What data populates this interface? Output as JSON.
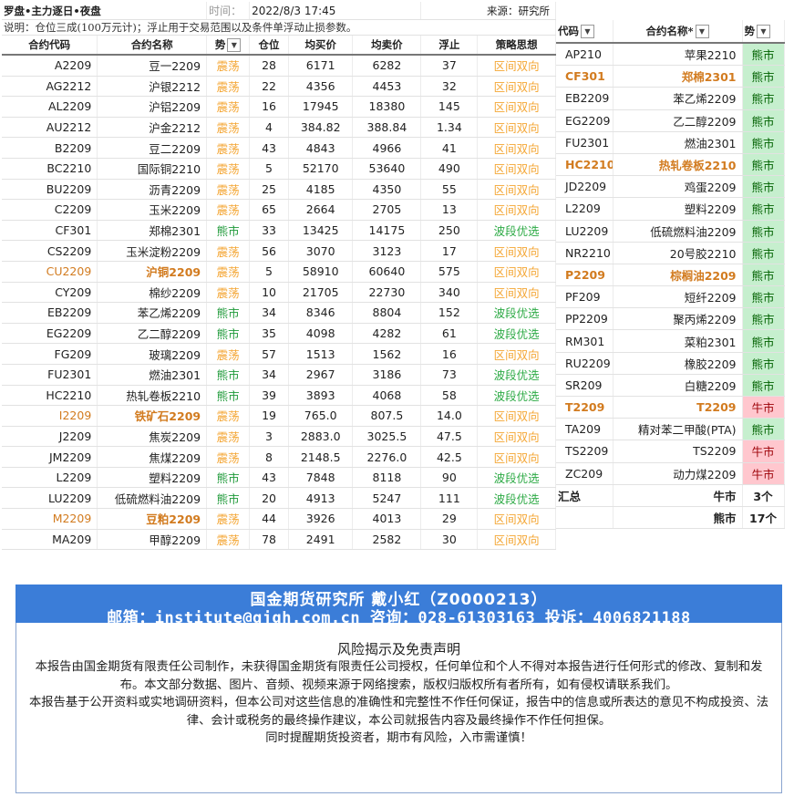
{
  "header": {
    "title": "罗盘•主力逐日•夜盘",
    "time_label": "时间：",
    "time_value": "2022/8/3 17:45",
    "source": "来源：研究所",
    "note": "说明：仓位三成(100万元计)；浮止用于交易范围以及条件单浮动止损参数。"
  },
  "left_table": {
    "columns": [
      "合约代码",
      "合约名称",
      "势",
      "仓位",
      "均买价",
      "均卖价",
      "浮止",
      "策略思想"
    ],
    "rows": [
      {
        "code": "A2209",
        "name": "豆一2209",
        "trend": "震荡",
        "pos": "28",
        "buy": "6171",
        "sell": "6282",
        "stop": "37",
        "strategy": "区间双向",
        "hl": false
      },
      {
        "code": "AG2212",
        "name": "沪银2212",
        "trend": "震荡",
        "pos": "22",
        "buy": "4356",
        "sell": "4453",
        "stop": "32",
        "strategy": "区间双向",
        "hl": false
      },
      {
        "code": "AL2209",
        "name": "沪铝2209",
        "trend": "震荡",
        "pos": "16",
        "buy": "17945",
        "sell": "18380",
        "stop": "145",
        "strategy": "区间双向",
        "hl": false
      },
      {
        "code": "AU2212",
        "name": "沪金2212",
        "trend": "震荡",
        "pos": "4",
        "buy": "384.82",
        "sell": "388.84",
        "stop": "1.34",
        "strategy": "区间双向",
        "hl": false
      },
      {
        "code": "B2209",
        "name": "豆二2209",
        "trend": "震荡",
        "pos": "43",
        "buy": "4843",
        "sell": "4966",
        "stop": "41",
        "strategy": "区间双向",
        "hl": false
      },
      {
        "code": "BC2210",
        "name": "国际铜2210",
        "trend": "震荡",
        "pos": "5",
        "buy": "52170",
        "sell": "53640",
        "stop": "490",
        "strategy": "区间双向",
        "hl": false
      },
      {
        "code": "BU2209",
        "name": "沥青2209",
        "trend": "震荡",
        "pos": "25",
        "buy": "4185",
        "sell": "4350",
        "stop": "55",
        "strategy": "区间双向",
        "hl": false
      },
      {
        "code": "C2209",
        "name": "玉米2209",
        "trend": "震荡",
        "pos": "65",
        "buy": "2664",
        "sell": "2705",
        "stop": "13",
        "strategy": "区间双向",
        "hl": false
      },
      {
        "code": "CF301",
        "name": "郑棉2301",
        "trend": "熊市",
        "pos": "33",
        "buy": "13425",
        "sell": "14175",
        "stop": "250",
        "strategy": "波段优选",
        "hl": false
      },
      {
        "code": "CS2209",
        "name": "玉米淀粉2209",
        "trend": "震荡",
        "pos": "56",
        "buy": "3070",
        "sell": "3123",
        "stop": "17",
        "strategy": "区间双向",
        "hl": false
      },
      {
        "code": "CU2209",
        "name": "沪铜2209",
        "trend": "震荡",
        "pos": "5",
        "buy": "58910",
        "sell": "60640",
        "stop": "575",
        "strategy": "区间双向",
        "hl": true
      },
      {
        "code": "CY209",
        "name": "棉纱2209",
        "trend": "震荡",
        "pos": "10",
        "buy": "21705",
        "sell": "22730",
        "stop": "340",
        "strategy": "区间双向",
        "hl": false
      },
      {
        "code": "EB2209",
        "name": "苯乙烯2209",
        "trend": "熊市",
        "pos": "34",
        "buy": "8346",
        "sell": "8804",
        "stop": "152",
        "strategy": "波段优选",
        "hl": false
      },
      {
        "code": "EG2209",
        "name": "乙二醇2209",
        "trend": "熊市",
        "pos": "35",
        "buy": "4098",
        "sell": "4282",
        "stop": "61",
        "strategy": "波段优选",
        "hl": false
      },
      {
        "code": "FG209",
        "name": "玻璃2209",
        "trend": "震荡",
        "pos": "57",
        "buy": "1513",
        "sell": "1562",
        "stop": "16",
        "strategy": "区间双向",
        "hl": false
      },
      {
        "code": "FU2301",
        "name": "燃油2301",
        "trend": "熊市",
        "pos": "34",
        "buy": "2967",
        "sell": "3186",
        "stop": "73",
        "strategy": "波段优选",
        "hl": false
      },
      {
        "code": "HC2210",
        "name": "热轧卷板2210",
        "trend": "熊市",
        "pos": "39",
        "buy": "3893",
        "sell": "4068",
        "stop": "58",
        "strategy": "波段优选",
        "hl": false
      },
      {
        "code": "I2209",
        "name": "铁矿石2209",
        "trend": "震荡",
        "pos": "19",
        "buy": "765.0",
        "sell": "807.5",
        "stop": "14.0",
        "strategy": "区间双向",
        "hl": true
      },
      {
        "code": "J2209",
        "name": "焦炭2209",
        "trend": "震荡",
        "pos": "3",
        "buy": "2883.0",
        "sell": "3025.5",
        "stop": "47.5",
        "strategy": "区间双向",
        "hl": false
      },
      {
        "code": "JM2209",
        "name": "焦煤2209",
        "trend": "震荡",
        "pos": "8",
        "buy": "2148.5",
        "sell": "2276.0",
        "stop": "42.5",
        "strategy": "区间双向",
        "hl": false
      },
      {
        "code": "L2209",
        "name": "塑料2209",
        "trend": "熊市",
        "pos": "43",
        "buy": "7848",
        "sell": "8118",
        "stop": "90",
        "strategy": "波段优选",
        "hl": false
      },
      {
        "code": "LU2209",
        "name": "低硫燃料油2209",
        "trend": "熊市",
        "pos": "20",
        "buy": "4913",
        "sell": "5247",
        "stop": "111",
        "strategy": "波段优选",
        "hl": false
      },
      {
        "code": "M2209",
        "name": "豆粕2209",
        "trend": "震荡",
        "pos": "44",
        "buy": "3926",
        "sell": "4013",
        "stop": "29",
        "strategy": "区间双向",
        "hl": true
      },
      {
        "code": "MA209",
        "name": "甲醇2209",
        "trend": "震荡",
        "pos": "78",
        "buy": "2491",
        "sell": "2582",
        "stop": "30",
        "strategy": "区间双向",
        "hl": false
      }
    ]
  },
  "right_table": {
    "columns": [
      "代码",
      "合约名称*",
      "势"
    ],
    "rows": [
      {
        "code": "AP210",
        "name": "苹果2210",
        "trend": "熊市",
        "hl": false
      },
      {
        "code": "CF301",
        "name": "郑棉2301",
        "trend": "熊市",
        "hl": true
      },
      {
        "code": "EB2209",
        "name": "苯乙烯2209",
        "trend": "熊市",
        "hl": false
      },
      {
        "code": "EG2209",
        "name": "乙二醇2209",
        "trend": "熊市",
        "hl": false
      },
      {
        "code": "FU2301",
        "name": "燃油2301",
        "trend": "熊市",
        "hl": false
      },
      {
        "code": "HC2210",
        "name": "热轧卷板2210",
        "trend": "熊市",
        "hl": true
      },
      {
        "code": "JD2209",
        "name": "鸡蛋2209",
        "trend": "熊市",
        "hl": false
      },
      {
        "code": "L2209",
        "name": "塑料2209",
        "trend": "熊市",
        "hl": false
      },
      {
        "code": "LU2209",
        "name": "低硫燃料油2209",
        "trend": "熊市",
        "hl": false
      },
      {
        "code": "NR2210",
        "name": "20号胶2210",
        "trend": "熊市",
        "hl": false
      },
      {
        "code": "P2209",
        "name": "棕榈油2209",
        "trend": "熊市",
        "hl": true
      },
      {
        "code": "PF209",
        "name": "短纤2209",
        "trend": "熊市",
        "hl": false
      },
      {
        "code": "PP2209",
        "name": "聚丙烯2209",
        "trend": "熊市",
        "hl": false
      },
      {
        "code": "RM301",
        "name": "菜粕2301",
        "trend": "熊市",
        "hl": false
      },
      {
        "code": "RU2209",
        "name": "橡胶2209",
        "trend": "熊市",
        "hl": false
      },
      {
        "code": "SR209",
        "name": "白糖2209",
        "trend": "熊市",
        "hl": false
      },
      {
        "code": "T2209",
        "name": "T2209",
        "trend": "牛市",
        "hl": true
      },
      {
        "code": "TA209",
        "name": "精对苯二甲酸(PTA)",
        "trend": "熊市",
        "hl": false
      },
      {
        "code": "TS2209",
        "name": "TS2209",
        "trend": "牛市",
        "hl": false
      },
      {
        "code": "ZC209",
        "name": "动力煤2209",
        "trend": "牛市",
        "hl": false
      }
    ],
    "summary_label": "汇总",
    "bull_label": "牛市",
    "bull_count": "3个",
    "bear_label": "熊市",
    "bear_count": "17个"
  },
  "footer": {
    "banner_line1": "国金期货研究所   戴小红（Z0000213）",
    "banner_line2": "邮箱：institute@gjqh.com.cn 咨询：028-61303163 投诉：4006821188",
    "disclaimer_title": "风险揭示及免责声明",
    "paragraph1": "本报告由国金期货有限责任公司制作，未获得国金期货有限责任公司授权，任何单位和个人不得对本报告进行任何形式的修改、复制和发布。本文部分数据、图片、音频、视频来源于网络搜索，版权归版权所有者所有，如有侵权请联系我们。",
    "paragraph2": "本报告基于公开资料或实地调研资料，但本公司对这些信息的准确性和完整性不作任何保证，报告中的信息或所表达的意见不构成投资、法律、会计或税务的最终操作建议，本公司就报告内容及最终操作不作任何担保。",
    "paragraph3": "同时提醒期货投资者，期市有风险，入市需谨慎！"
  },
  "colors": {
    "banner_bg": "#3b7dd8",
    "highlight_orange": "#d27b1f",
    "shock_orange": "#f4a634",
    "bear_green": "#1f9a3a",
    "bull_fill": "#ffc7ce",
    "bear_fill": "#c6efce"
  },
  "icons": {
    "dropdown": "chevron-down-icon",
    "filter": "filter-icon"
  }
}
